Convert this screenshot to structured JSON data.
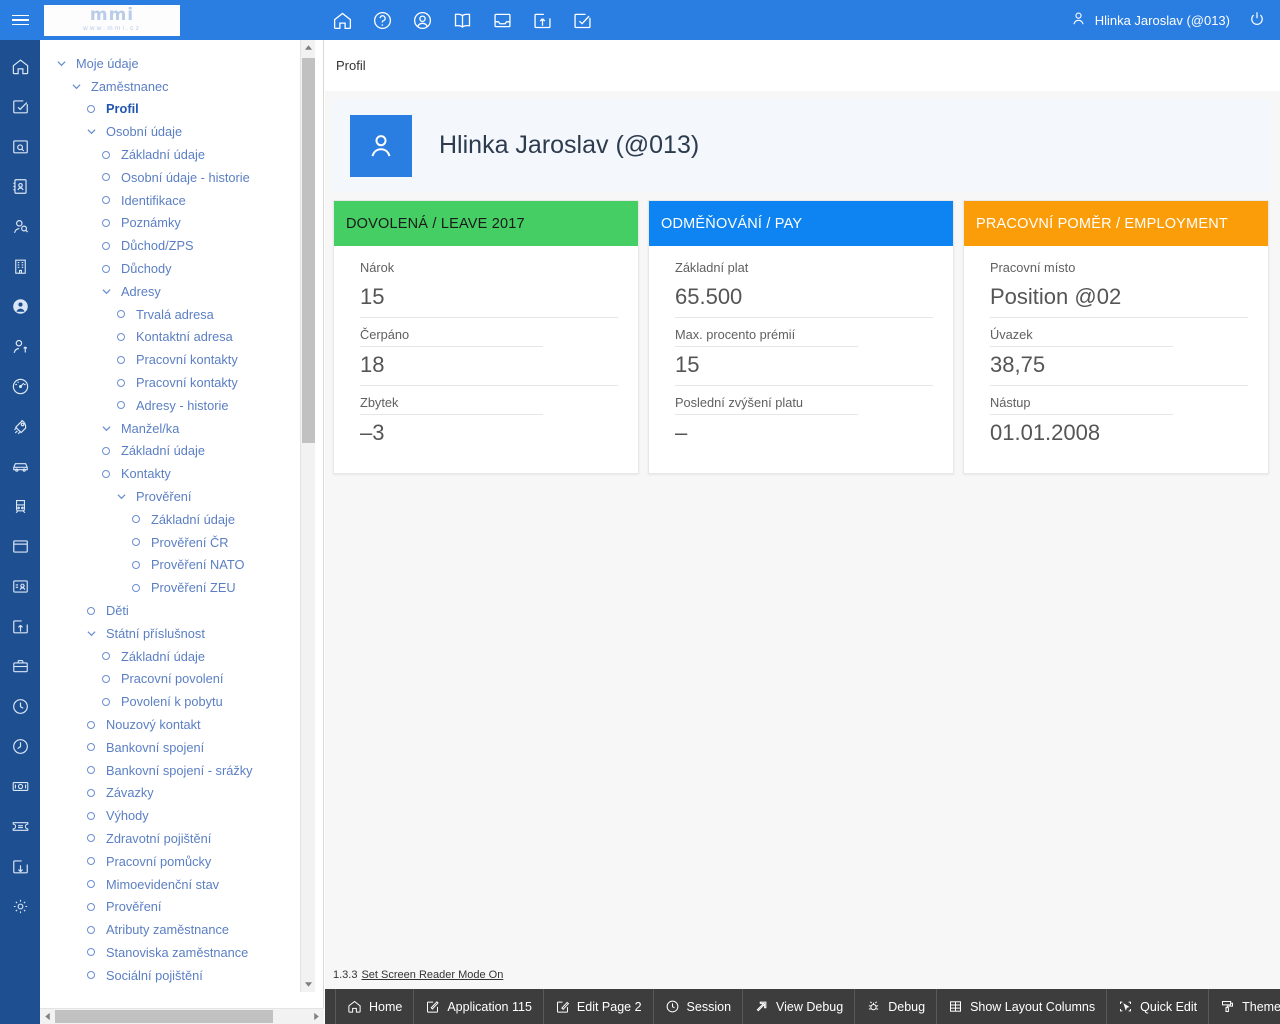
{
  "header": {
    "menu_icon": "hamburger-icon",
    "logo_main": "mmi",
    "logo_sub": "www.mmi.cz",
    "icons": [
      {
        "name": "home-icon"
      },
      {
        "name": "help-circle-icon"
      },
      {
        "name": "support-target-icon"
      },
      {
        "name": "book-icon"
      },
      {
        "name": "inbox-icon"
      },
      {
        "name": "upload-box-icon"
      },
      {
        "name": "task-check-icon"
      }
    ],
    "user_name": "Hlinka Jaroslav (@013)",
    "user_icon": "person-icon",
    "logout_icon": "power-icon"
  },
  "rail": {
    "items": [
      {
        "name": "home-icon"
      },
      {
        "name": "window-check-icon"
      },
      {
        "name": "window-search-icon"
      },
      {
        "name": "address-book-icon"
      },
      {
        "name": "user-search-icon"
      },
      {
        "name": "building-icon"
      },
      {
        "name": "user-circle-filled-icon"
      },
      {
        "name": "user-add-icon"
      },
      {
        "name": "dashboard-icon"
      },
      {
        "name": "rocket-icon"
      },
      {
        "name": "car-icon"
      },
      {
        "name": "train-icon"
      },
      {
        "name": "window-icon"
      },
      {
        "name": "id-card-icon"
      },
      {
        "name": "window-upload-icon"
      },
      {
        "name": "briefcase-icon"
      },
      {
        "name": "clock-icon"
      },
      {
        "name": "clock-history-icon"
      },
      {
        "name": "money-icon"
      },
      {
        "name": "ticket-icon"
      },
      {
        "name": "window-download-icon"
      },
      {
        "name": "gear-icon"
      }
    ]
  },
  "tree": {
    "items": [
      {
        "label": "Moje údaje",
        "indent": 0,
        "marker": "chevron",
        "bold": false
      },
      {
        "label": "Zaměstnanec",
        "indent": 1,
        "marker": "chevron",
        "bold": false
      },
      {
        "label": "Profil",
        "indent": 2,
        "marker": "circle",
        "bold": true
      },
      {
        "label": "Osobní údaje",
        "indent": 2,
        "marker": "chevron",
        "bold": false
      },
      {
        "label": "Základní údaje",
        "indent": 3,
        "marker": "circle",
        "bold": false
      },
      {
        "label": "Osobní údaje - historie",
        "indent": 3,
        "marker": "circle",
        "bold": false
      },
      {
        "label": "Identifikace",
        "indent": 3,
        "marker": "circle",
        "bold": false
      },
      {
        "label": "Poznámky",
        "indent": 3,
        "marker": "circle",
        "bold": false
      },
      {
        "label": "Důchod/ZPS",
        "indent": 3,
        "marker": "circle",
        "bold": false
      },
      {
        "label": "Důchody",
        "indent": 3,
        "marker": "circle",
        "bold": false
      },
      {
        "label": "Adresy",
        "indent": 3,
        "marker": "chevron",
        "bold": false
      },
      {
        "label": "Trvalá adresa",
        "indent": 4,
        "marker": "circle",
        "bold": false
      },
      {
        "label": "Kontaktní adresa",
        "indent": 4,
        "marker": "circle",
        "bold": false
      },
      {
        "label": "Pracovní kontakty",
        "indent": 4,
        "marker": "circle",
        "bold": false
      },
      {
        "label": "Pracovní kontakty",
        "indent": 4,
        "marker": "circle",
        "bold": false
      },
      {
        "label": "Adresy - historie",
        "indent": 4,
        "marker": "circle",
        "bold": false
      },
      {
        "label": "Manžel/ka",
        "indent": 3,
        "marker": "chevron",
        "bold": false
      },
      {
        "label": "Základní údaje",
        "indent": 3,
        "marker": "circle",
        "bold": false
      },
      {
        "label": "Kontakty",
        "indent": 3,
        "marker": "circle",
        "bold": false
      },
      {
        "label": "Prověření",
        "indent": 4,
        "marker": "chevron",
        "bold": false
      },
      {
        "label": "Základní údaje",
        "indent": 5,
        "marker": "circle",
        "bold": false
      },
      {
        "label": "Prověření ČR",
        "indent": 5,
        "marker": "circle",
        "bold": false
      },
      {
        "label": "Prověření NATO",
        "indent": 5,
        "marker": "circle",
        "bold": false
      },
      {
        "label": "Prověření ZEU",
        "indent": 5,
        "marker": "circle",
        "bold": false
      },
      {
        "label": "Děti",
        "indent": 2,
        "marker": "circle",
        "bold": false
      },
      {
        "label": "Státní příslušnost",
        "indent": 2,
        "marker": "chevron",
        "bold": false
      },
      {
        "label": "Základní údaje",
        "indent": 3,
        "marker": "circle",
        "bold": false
      },
      {
        "label": "Pracovní povolení",
        "indent": 3,
        "marker": "circle",
        "bold": false
      },
      {
        "label": "Povolení k pobytu",
        "indent": 3,
        "marker": "circle",
        "bold": false
      },
      {
        "label": "Nouzový kontakt",
        "indent": 2,
        "marker": "circle",
        "bold": false
      },
      {
        "label": "Bankovní spojení",
        "indent": 2,
        "marker": "circle",
        "bold": false
      },
      {
        "label": "Bankovní spojení - srážky",
        "indent": 2,
        "marker": "circle",
        "bold": false
      },
      {
        "label": "Závazky",
        "indent": 2,
        "marker": "circle",
        "bold": false
      },
      {
        "label": "Výhody",
        "indent": 2,
        "marker": "circle",
        "bold": false
      },
      {
        "label": "Zdravotní pojištění",
        "indent": 2,
        "marker": "circle",
        "bold": false
      },
      {
        "label": "Pracovní pomůcky",
        "indent": 2,
        "marker": "circle",
        "bold": false
      },
      {
        "label": "Mimoevidenční stav",
        "indent": 2,
        "marker": "circle",
        "bold": false
      },
      {
        "label": "Prověření",
        "indent": 2,
        "marker": "circle",
        "bold": false
      },
      {
        "label": "Atributy zaměstnance",
        "indent": 2,
        "marker": "circle",
        "bold": false
      },
      {
        "label": "Stanoviska zaměstnance",
        "indent": 2,
        "marker": "circle",
        "bold": false
      },
      {
        "label": "Sociální pojištění",
        "indent": 2,
        "marker": "circle",
        "bold": false
      }
    ]
  },
  "main": {
    "breadcrumb": "Profil",
    "profile_name": "Hlinka Jaroslav (@013)",
    "avatar_icon": "person-icon",
    "version": "1.3.3",
    "screen_reader_link": "Set Screen Reader Mode On",
    "cards": [
      {
        "title": "DOVOLENÁ / LEAVE 2017",
        "color": "green",
        "accent": "#45ce63",
        "rows": [
          {
            "label": "Nárok",
            "value": "15"
          },
          {
            "label": "Čerpáno",
            "value": "18"
          },
          {
            "label": "Zbytek",
            "value": "–3"
          }
        ]
      },
      {
        "title": "ODMĚŇOVÁNÍ / PAY",
        "color": "blue",
        "accent": "#0d84f2",
        "rows": [
          {
            "label": "Základní plat",
            "value": "65.500"
          },
          {
            "label": "Max. procento prémií",
            "value": "15"
          },
          {
            "label": "Poslední zvýšení platu",
            "value": "–"
          }
        ]
      },
      {
        "title": "PRACOVNÍ POMĚR / EMPLOYMENT",
        "color": "orange",
        "accent": "#fb9c09",
        "rows": [
          {
            "label": "Pracovní místo",
            "value": "Position @02"
          },
          {
            "label": "Úvazek",
            "value": "38,75"
          },
          {
            "label": "Nástup",
            "value": "01.01.2008"
          }
        ]
      }
    ]
  },
  "devbar": {
    "items": [
      {
        "label": "Home",
        "icon": "home-icon"
      },
      {
        "label": "Application 115",
        "icon": "edit-square-icon"
      },
      {
        "label": "Edit Page 2",
        "icon": "pencil-square-icon"
      },
      {
        "label": "Session",
        "icon": "clock-icon"
      },
      {
        "label": "View Debug",
        "icon": "arrow-expand-icon"
      },
      {
        "label": "Debug",
        "icon": "bug-icon"
      },
      {
        "label": "Show Layout Columns",
        "icon": "grid-icon"
      },
      {
        "label": "Quick Edit",
        "icon": "select-cursor-icon"
      },
      {
        "label": "Theme Roller",
        "icon": "paint-roller-icon"
      }
    ],
    "settings_icon": "gear-icon"
  },
  "colors": {
    "header_blue": "#2a7de1",
    "rail_blue": "#1d4f91",
    "tree_text": "#5b7fc4",
    "devbar": "#3d3d3d"
  }
}
